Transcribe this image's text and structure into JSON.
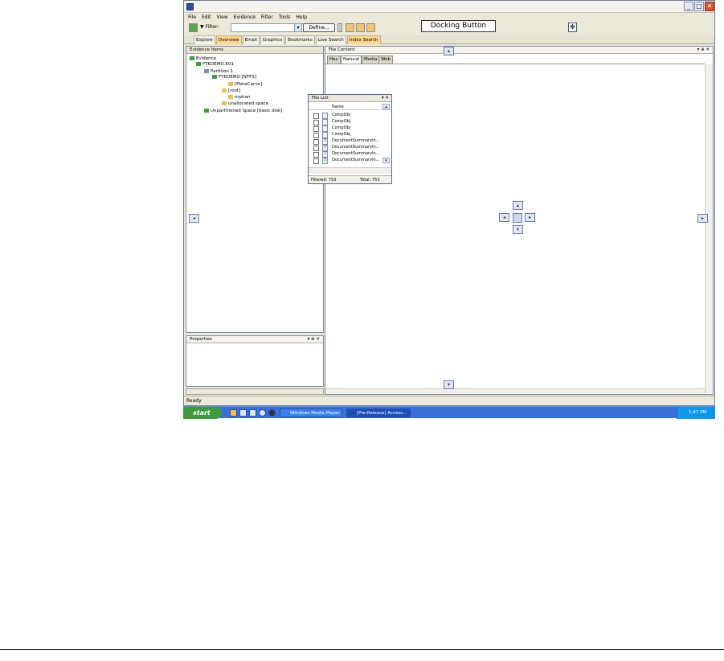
{
  "window": {
    "min_label": "_",
    "max_label": "□",
    "close_label": "✕"
  },
  "menu": [
    "File",
    "Edit",
    "View",
    "Evidence",
    "Filter",
    "Tools",
    "Help"
  ],
  "toolbar": {
    "filter_label": "Filter:",
    "filter_value": "",
    "define_label": "Define..."
  },
  "tabs": [
    "Explore",
    "Overview",
    "Email",
    "Graphics",
    "Bookmarks",
    "Live Search",
    "Index Search"
  ],
  "evidence_pane": {
    "tab_label": "Evidence Items",
    "tree": [
      "Evidence",
      "FTKDEMO.E01",
      "Partition 1",
      "FTKDEMO [NTFS]",
      "[MetaCarve]",
      "[root]",
      "orphan",
      "unallocated space",
      "Unpartitioned Space [basic disk]"
    ]
  },
  "properties_pane": {
    "title": "Properties",
    "controls": "▾ ⊕ ✕"
  },
  "file_content": {
    "title": "File Content",
    "controls": "▾ ⊕ ✕",
    "subtabs": [
      "Hex",
      "Natural",
      "Media",
      "Web"
    ]
  },
  "file_list": {
    "title": "File List",
    "controls": "▾ ✕",
    "column": "Name",
    "rows": [
      "CompObj",
      "CompObj",
      "CompObj",
      "CompObj",
      "DocumentSummaryIn...",
      "DocumentSummaryIn...",
      "DocumentSummaryIn...",
      "DocumentSummaryIn..."
    ],
    "filtered_label": "Filtered: 753",
    "total_label": "Total: 753"
  },
  "callout": {
    "text": "Docking Button"
  },
  "status": {
    "text": "Ready"
  },
  "taskbar": {
    "start_label": "start",
    "tasks": [
      "Windows Media Player",
      "[Pre-Release] Access..."
    ],
    "clock": "1:47 PM"
  }
}
